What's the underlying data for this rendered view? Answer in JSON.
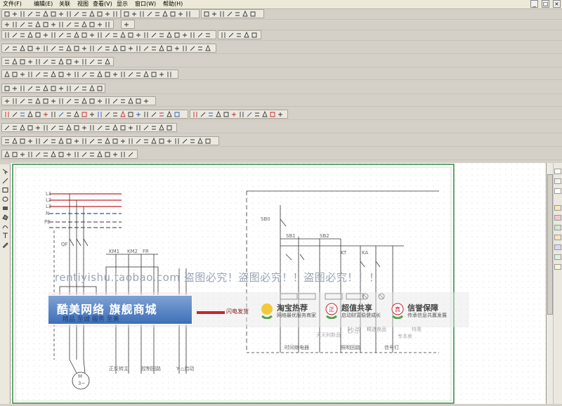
{
  "menubar": {
    "items": [
      "文件(F)",
      "编辑(E)",
      "关联",
      "视图",
      "查看(V)",
      "显示",
      "窗口(W)",
      "帮助(H)"
    ],
    "window_buttons": [
      "_",
      "□",
      "×"
    ]
  },
  "watermark": {
    "url_text": "rentiyishu.taobao.com  盗图必究！盗图必究！！盗图必究！！！",
    "shop_title": "酷美网络 旗舰商城",
    "shop_sub": "精品 至诚 服务 至美",
    "flash_text": "闪电发货",
    "badges": [
      {
        "title": "淘宝热荐",
        "sub": "网络最优服务商家",
        "mark": "!"
      },
      {
        "title": "超值共享",
        "sub": "启动财富稳健成长",
        "mark": "正"
      },
      {
        "title": "信誉保障",
        "sub": "传承信息共赢发展",
        "mark": "真"
      }
    ],
    "faint_labels": [
      "天天利新品",
      "秒杀",
      "精选良品",
      "特惠",
      "专本卖"
    ]
  },
  "schematic": {
    "labels": [
      "L1",
      "L2",
      "L3",
      "N",
      "PE",
      "QF",
      "KM1",
      "KM2",
      "FR",
      "SB0",
      "SB1",
      "SB2",
      "KT",
      "KA",
      "M",
      "3~"
    ],
    "bottom_labels": [
      "正反转主",
      "控制回路",
      "Y-△启动",
      "时间继电器",
      "照明回路",
      "信号灯"
    ]
  },
  "colors": {
    "accent_red": "#c8242c",
    "accent_blue": "#2f59b8",
    "grid_green": "#2e8b3e"
  }
}
